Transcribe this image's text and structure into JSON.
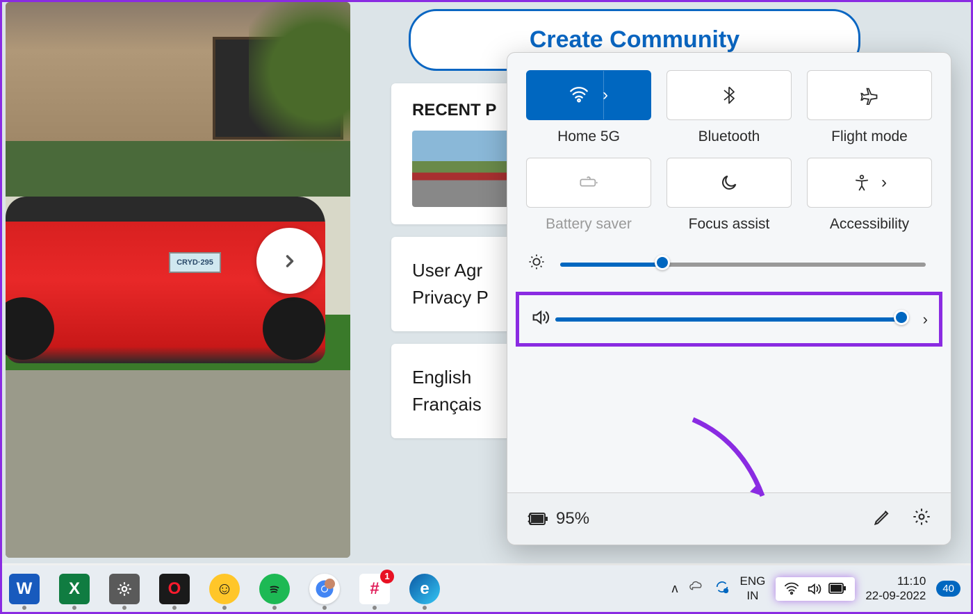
{
  "browser": {
    "community_button": "Create Community",
    "recent_heading": "RECENT P",
    "user_agreement": "User Agr",
    "privacy_policy": "Privacy P",
    "lang_en": "English",
    "lang_fr": "Français",
    "plate": "CRYD·295"
  },
  "quick_settings": {
    "wifi": {
      "label": "Home 5G"
    },
    "bluetooth": {
      "label": "Bluetooth"
    },
    "flight": {
      "label": "Flight mode"
    },
    "battery_saver": {
      "label": "Battery saver"
    },
    "focus": {
      "label": "Focus assist"
    },
    "accessibility": {
      "label": "Accessibility"
    },
    "brightness_pct": 28,
    "volume_pct": 100,
    "battery_text": "95%"
  },
  "taskbar": {
    "lang_code": "ENG",
    "lang_region": "IN",
    "time": "11:10",
    "date": "22-09-2022",
    "notif_count": "40"
  }
}
